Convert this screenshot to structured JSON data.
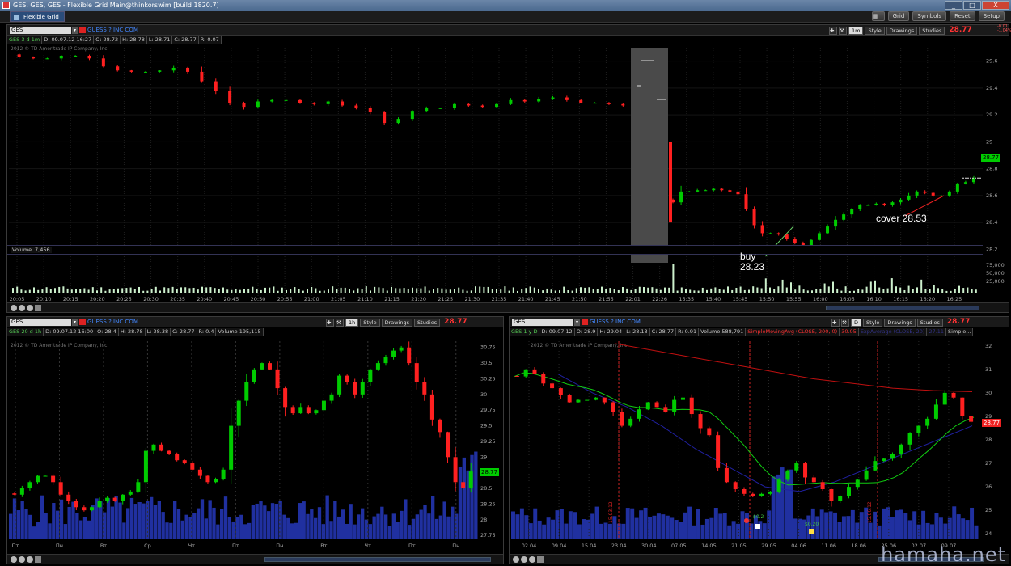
{
  "window": {
    "title": "GES, GES, GES - Flexible Grid Main@thinkorswim [build 1820.7]",
    "buttons": [
      "_",
      "□",
      "X"
    ]
  },
  "menubar": {
    "tab_label": "Flexible Grid",
    "buttons": [
      "Grid",
      "Symbols",
      "Reset",
      "Setup"
    ]
  },
  "watermark": "hamaha.net",
  "colors": {
    "up": "#00cc00",
    "down": "#ff2020",
    "volume_small": "#2030a0",
    "sma": "#c01010",
    "ema": "#2020a0"
  },
  "top_chart": {
    "symbol": "GES",
    "company": "GUESS ? INC COM",
    "aggregation": "1m",
    "style_label": "Style",
    "drawings_label": "Drawings",
    "studies_label": "Studies",
    "last_price": "28.77",
    "change": "-0.01",
    "change_pct": "-1.04%",
    "info": {
      "title": "GES 3 d 1m",
      "date": "D: 09.07.12 16:27",
      "open": "O: 28.72",
      "high": "H: 28.78",
      "low": "L: 28.71",
      "close": "C: 28.77",
      "range": "R: 0.07"
    },
    "copyright": "2012 © TD Ameritrade IP Company, Inc.",
    "volume_label": "Volume",
    "volume_value": "7,456",
    "price_marker": "28.77",
    "volume_axis": [
      "75,000",
      "50,000",
      "25,000"
    ],
    "annotations": {
      "buy_label": "buy",
      "buy_price": "28.23",
      "cover_label": "cover 28.53"
    }
  },
  "left_chart": {
    "symbol": "GES",
    "company": "GUESS ? INC COM",
    "aggregation": "1h",
    "style_label": "Style",
    "drawings_label": "Drawings",
    "studies_label": "Studies",
    "last_price": "28.77",
    "info": {
      "title": "GES 20 d 1h",
      "date": "D: 09.07.12 16:00",
      "open": "O: 28.4",
      "high": "H: 28.78",
      "low": "L: 28.38",
      "close": "C: 28.77",
      "range": "R: 0.4",
      "volume": "Volume 195,115"
    },
    "copyright": "2012 © TD Ameritrade IP Company, Inc.",
    "price_marker": "28.77"
  },
  "right_chart": {
    "symbol": "GES",
    "company": "GUESS ? INC COM",
    "aggregation": "D",
    "style_label": "Style",
    "drawings_label": "Drawings",
    "studies_label": "Studies",
    "last_price": "28.77",
    "info": {
      "title": "GES 1 y D",
      "date": "D: 09.07.12",
      "open": "O: 28.9",
      "high": "H: 29.04",
      "low": "L: 28.13",
      "close": "C: 28.77",
      "range": "R: 0.91",
      "volume": "Volume 588,791",
      "sma": "SimpleMovingAvg (CLOSE, 200, 0)",
      "sma_value": "30.05",
      "ema": "ExpAverage (CLOSE, 20)",
      "ema_value": "27.11",
      "more": "Simple..."
    },
    "copyright": "2012 © TD Ameritrade IP Company, Inc.",
    "price_marker": "28.77",
    "dividends": [
      "$0.2",
      "$0.20"
    ],
    "event_labels": [
      "15.03.12",
      "15.06.12"
    ]
  },
  "chart_data": [
    {
      "type": "candlestick",
      "title": "GES 3 d 1m",
      "y_ticks": [
        28.2,
        28.4,
        28.6,
        28.8,
        29,
        29.2,
        29.4,
        29.6
      ],
      "ylim": [
        28.1,
        29.7
      ],
      "x_ticks": [
        "20:05",
        "20:10",
        "20:15",
        "20:20",
        "20:25",
        "20:30",
        "20:35",
        "20:40",
        "20:45",
        "20:50",
        "20:55",
        "21:00",
        "21:05",
        "21:10",
        "21:15",
        "21:20",
        "21:25",
        "21:30",
        "21:35",
        "21:40",
        "21:45",
        "21:50",
        "21:55",
        "22:01",
        "22:26",
        "15:35",
        "15:40",
        "15:45",
        "15:50",
        "15:55",
        "16:00",
        "16:05",
        "16:10",
        "16:15",
        "16:20",
        "16:25"
      ],
      "session1_closes": [
        29.63,
        29.62,
        29.62,
        29.64,
        29.64,
        29.62,
        29.56,
        29.53,
        29.52,
        29.52,
        29.53,
        29.55,
        29.52,
        29.45,
        29.38,
        29.29,
        29.26,
        29.3,
        29.31,
        29.31,
        29.29,
        29.28,
        29.3,
        29.27,
        29.25,
        29.22,
        29.14,
        29.17,
        29.23,
        29.25,
        29.25,
        29.28,
        29.27,
        29.26,
        29.28,
        29.31,
        29.3,
        29.32,
        29.33,
        29.31,
        29.29,
        29.29,
        29.28,
        29.27
      ],
      "session2_closes": [
        28.55,
        28.63,
        28.63,
        28.64,
        28.64,
        28.65,
        28.64,
        28.63,
        28.61,
        28.5,
        28.38,
        28.32,
        28.32,
        28.31,
        28.28,
        28.25,
        28.23,
        28.27,
        28.32,
        28.37,
        28.42,
        28.46,
        28.5,
        28.53,
        28.53,
        28.54,
        28.53,
        28.55,
        28.57,
        28.6,
        28.63,
        28.62,
        28.6,
        28.6,
        28.63,
        28.69,
        28.7,
        28.73
      ]
    },
    {
      "type": "candlestick",
      "title": "GES 20 d 1h",
      "y_ticks": [
        27.75,
        28,
        28.25,
        28.5,
        28.75,
        29,
        29.25,
        29.5,
        29.75,
        30,
        30.25,
        30.5,
        30.75
      ],
      "ylim": [
        27.7,
        30.85
      ],
      "x_ticks": [
        "Пт",
        "Пн",
        "Вт",
        "Ср",
        "Чт",
        "Пт",
        "Пн",
        "Вт",
        "Чт",
        "Пт",
        "Пн"
      ],
      "closes": [
        28.4,
        28.5,
        28.6,
        28.7,
        28.7,
        28.6,
        28.4,
        28.3,
        28.2,
        28.15,
        28.2,
        28.3,
        28.35,
        28.3,
        28.4,
        28.45,
        28.6,
        29.1,
        29.2,
        29.1,
        29.05,
        28.95,
        28.9,
        28.8,
        28.7,
        28.6,
        28.65,
        28.8,
        29.5,
        29.9,
        30.2,
        30.4,
        30.5,
        30.4,
        30.1,
        29.8,
        29.7,
        29.8,
        29.7,
        29.75,
        29.9,
        30.0,
        30.3,
        30.2,
        30.0,
        30.2,
        30.4,
        30.5,
        30.6,
        30.7,
        30.75,
        30.5,
        30.2,
        30.0,
        29.6,
        29.4,
        29.0,
        28.6,
        28.5,
        28.77
      ],
      "volume_scale": "relative"
    },
    {
      "type": "candlestick",
      "title": "GES 1 y D",
      "y_ticks": [
        24,
        25,
        26,
        27,
        28,
        29,
        30,
        31,
        32
      ],
      "ylim": [
        23.8,
        32.2
      ],
      "x_ticks": [
        "02.04",
        "09.04",
        "15.04",
        "23.04",
        "30.04",
        "07.05",
        "14.05",
        "21.05",
        "29.05",
        "04.06",
        "11.06",
        "18.06",
        "25.06",
        "02.07",
        "09.07"
      ],
      "closes": [
        30.7,
        31.0,
        30.8,
        30.4,
        30.2,
        29.9,
        29.6,
        29.7,
        29.7,
        29.8,
        29.6,
        29.2,
        28.6,
        28.9,
        29.3,
        29.6,
        29.4,
        29.2,
        29.7,
        29.8,
        29.1,
        28.5,
        28.2,
        26.8,
        26.2,
        25.9,
        25.7,
        25.6,
        25.7,
        25.8,
        26.3,
        26.7,
        27.0,
        26.4,
        26.2,
        25.9,
        25.4,
        25.6,
        26.0,
        26.3,
        26.7,
        27.1,
        27.2,
        27.4,
        27.8,
        28.3,
        28.6,
        28.9,
        29.5,
        30.0,
        29.8,
        29.0,
        28.77
      ],
      "sma200": [
        32.1,
        31.8,
        31.5,
        31.2,
        30.9,
        30.6,
        30.4,
        30.2,
        30.1,
        30.05
      ],
      "ema20": [
        30.8,
        30.0,
        29.4,
        28.6,
        27.6,
        26.8,
        26.0,
        25.8,
        26.2,
        26.8,
        27.4,
        28.0,
        28.6
      ]
    }
  ]
}
